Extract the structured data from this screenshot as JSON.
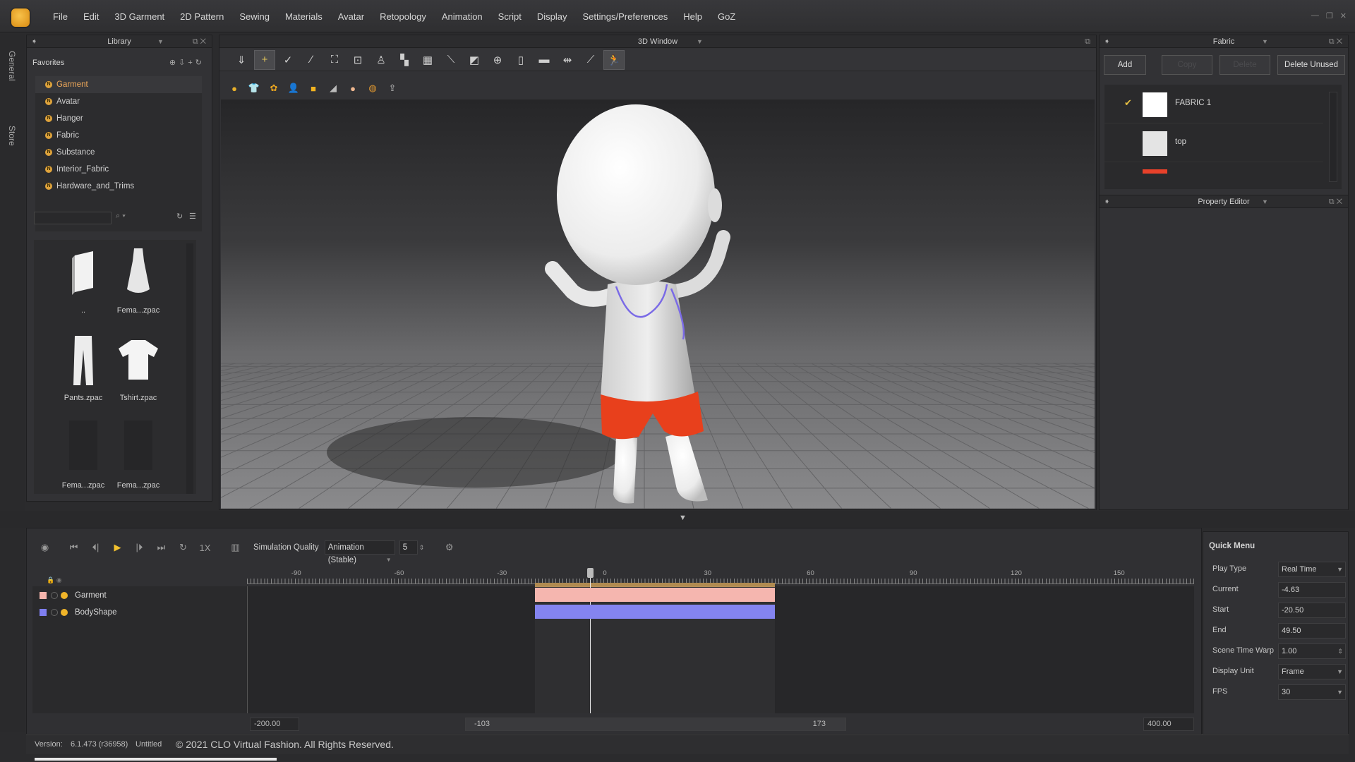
{
  "app": {
    "menu": [
      "File",
      "Edit",
      "3D Garment",
      "2D Pattern",
      "Sewing",
      "Materials",
      "Avatar",
      "Retopology",
      "Animation",
      "Script",
      "Display",
      "Settings/Preferences",
      "Help",
      "GoZ"
    ]
  },
  "left_tabs": [
    "General",
    "Store"
  ],
  "library": {
    "title": "Library",
    "favorites_label": "Favorites",
    "items": [
      {
        "label": "Garment",
        "selected": true
      },
      {
        "label": "Avatar"
      },
      {
        "label": "Hanger"
      },
      {
        "label": "Fabric"
      },
      {
        "label": "Substance"
      },
      {
        "label": "Interior_Fabric"
      },
      {
        "label": "Hardware_and_Trims"
      }
    ],
    "search_value": "",
    "thumbnails": [
      {
        "label": "..",
        "icon": "folder-up-icon"
      },
      {
        "label": "Fema...zpac",
        "icon": "dress-icon"
      },
      {
        "label": "Pants.zpac",
        "icon": "pants-icon"
      },
      {
        "label": "Tshirt.zpac",
        "icon": "tshirt-icon"
      },
      {
        "label": "Fema...zpac",
        "icon": "dark-garment-icon"
      },
      {
        "label": "Fema...zpac",
        "icon": "dark-garment-icon"
      }
    ]
  },
  "view3d": {
    "title": "3D Window",
    "toolbar1": [
      "select-mesh-icon",
      "transform-pin-icon",
      "edit-curvature-icon",
      "edit-pin-icon",
      "garment-fit-icon",
      "fold-arrangement-icon",
      "avatar-pose-icon",
      "tack-icon",
      "grid-icon",
      "strap-icon",
      "trim-icon",
      "button-icon",
      "zipper-icon",
      "topstitch-icon",
      "measure-icon",
      "tape-icon",
      "simulation-icon"
    ],
    "toolbar1_active": [
      1,
      16
    ],
    "toolbar2": [
      {
        "icon": "show-avatar-icon",
        "color": "#e8b02a"
      },
      {
        "icon": "show-garment-icon",
        "color": "#dddddd"
      },
      {
        "icon": "texture-icon",
        "color": "#e8a420"
      },
      {
        "icon": "avatar-silhouette-icon",
        "color": "#dddddd"
      },
      {
        "icon": "fabric-render-icon",
        "color": "#f2b320"
      },
      {
        "icon": "wireframe-icon",
        "color": "#bbbbbb"
      },
      {
        "icon": "skin-icon",
        "color": "#f0b890"
      },
      {
        "icon": "pattern-grid-icon",
        "color": "#e09830"
      },
      {
        "icon": "export-icon",
        "color": "#bbbbbb"
      }
    ]
  },
  "fabric_panel": {
    "title": "Fabric",
    "buttons": [
      {
        "label": "Add",
        "enabled": true
      },
      {
        "label": "Copy",
        "enabled": false
      },
      {
        "label": "Delete",
        "enabled": false
      },
      {
        "label": "Delete Unused",
        "enabled": true
      }
    ],
    "items": [
      {
        "name": "FABRIC 1",
        "swatch": "#ffffff",
        "checked": true
      },
      {
        "name": "top",
        "swatch": "#e4e4e4",
        "checked": false
      },
      {
        "name": "",
        "swatch": "#e8412a",
        "checked": false
      }
    ]
  },
  "property_editor": {
    "title": "Property Editor"
  },
  "timeline": {
    "speed_label": "1X",
    "sim_quality_label": "Simulation Quality",
    "sim_quality_value": "Animation (Stable)",
    "steps_value": "5",
    "ruler_ticks": [
      -90,
      -60,
      -30,
      0,
      30,
      60,
      90,
      120,
      150
    ],
    "tracks": [
      {
        "name": "Garment",
        "color": "#f5b4ac"
      },
      {
        "name": "BodyShape",
        "color": "#7f7ff0"
      }
    ],
    "range_start": -20.5,
    "range_end": 49.5,
    "current": -4.63,
    "scroll_min": "-200.00",
    "scroll_left": "-103",
    "scroll_right": "173",
    "scroll_max": "400.00"
  },
  "quick_menu": {
    "title": "Quick Menu",
    "fields": [
      {
        "label": "Play Type",
        "value": "Real Time",
        "kind": "select"
      },
      {
        "label": "Current",
        "value": "-4.63",
        "kind": "input"
      },
      {
        "label": "Start",
        "value": "-20.50",
        "kind": "input"
      },
      {
        "label": "End",
        "value": "49.50",
        "kind": "input"
      },
      {
        "label": "Scene Time Warp",
        "value": "1.00",
        "kind": "spin"
      },
      {
        "label": "Display Unit",
        "value": "Frame",
        "kind": "select"
      },
      {
        "label": "FPS",
        "value": "30",
        "kind": "select"
      }
    ]
  },
  "status": {
    "version_label": "Version:",
    "version": "6.1.473 (r36958)",
    "file": "Untitled",
    "copyright": "© 2021 CLO Virtual Fashion. All Rights Reserved."
  },
  "colors": {
    "accent": "#f0a95a",
    "garment_track": "#f5b4ac",
    "body_track": "#7f7ff0",
    "shorts": "#e8401c"
  }
}
